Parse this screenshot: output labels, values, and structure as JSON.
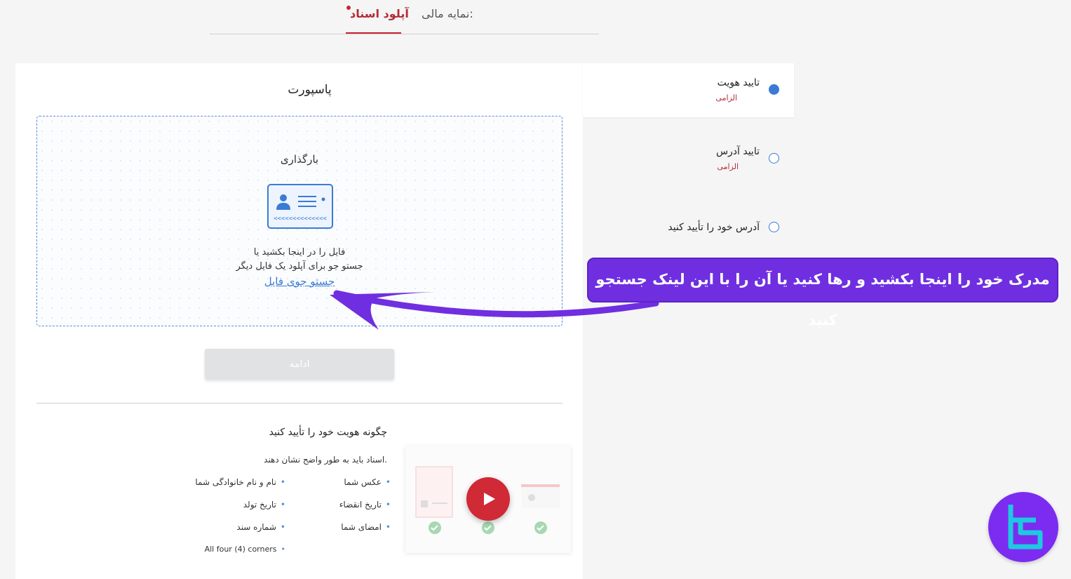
{
  "tabs": {
    "upload": "آپلود اسناد",
    "financial": "نمایه مالی:"
  },
  "panel": {
    "title": "پاسپورت",
    "dropzone": {
      "title": "بارگذاری",
      "line1": "فایل را در اینجا بکشید یا",
      "line2": "جستو جو برای آپلود یک فایل دیگر",
      "browse_link": "جستو جوی فایل"
    },
    "continue_label": "ادامه",
    "how": {
      "title": "چگونه هویت خود را تأیید کنید",
      "subtitle": "اسناد باید به طور واضح نشان دهند.",
      "requirements_right": [
        "عکس شما",
        "تاریخ انقضاء",
        "امضای شما"
      ],
      "requirements_left": [
        "نام و نام خانوادگی شما",
        "تاریخ تولد",
        "شماره سند",
        "All four (4) corners"
      ]
    }
  },
  "steps": [
    {
      "label": "تایید هویت",
      "required": "الزامی",
      "active": true
    },
    {
      "label": "تایید آدرس",
      "required": "الزامی",
      "active": false
    },
    {
      "label": "آدرس خود را تأیید کنید",
      "required": "",
      "active": false
    }
  ],
  "callout": {
    "text": "مدرک خود را اینجا بکشید و رها کنید یا آن را با این لینک جستجو کنید"
  },
  "colors": {
    "accent": "#3a7bd5",
    "brand_red": "#c9252f",
    "callout_purple": "#6f2fe0"
  }
}
